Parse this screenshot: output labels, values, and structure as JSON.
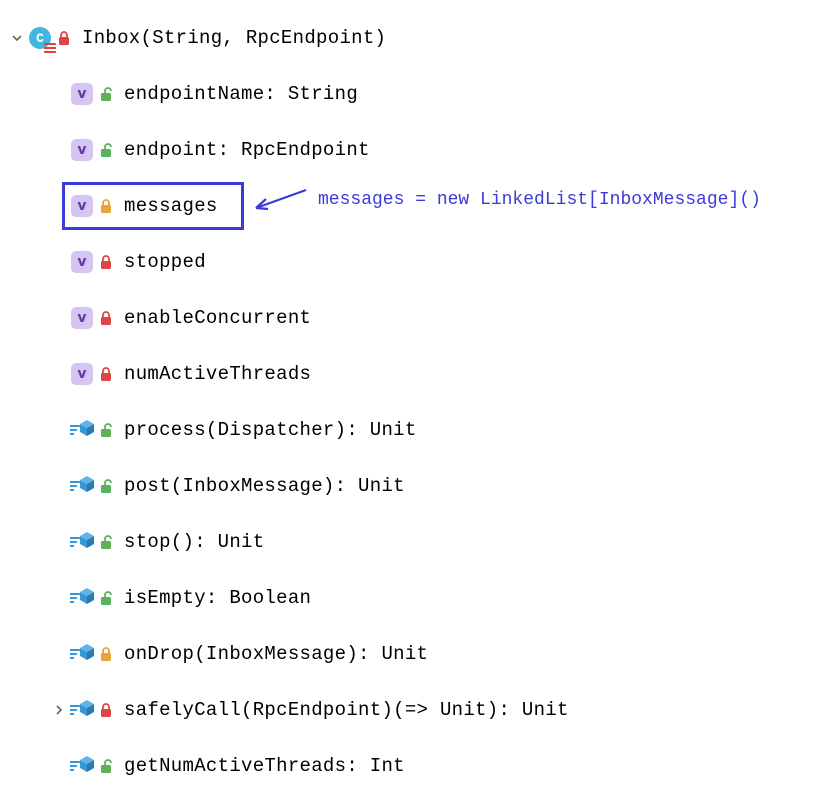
{
  "header": {
    "label": "Inbox(String, RpcEndpoint)",
    "lock": "locked-red"
  },
  "members": [
    {
      "kind": "val",
      "lock": "open-green",
      "label": "endpointName: String"
    },
    {
      "kind": "val",
      "lock": "open-green",
      "label": "endpoint: RpcEndpoint"
    },
    {
      "kind": "val",
      "lock": "locked-gold",
      "label": "messages",
      "highlight": true,
      "annotation": "messages = new LinkedList[InboxMessage]()"
    },
    {
      "kind": "val",
      "lock": "locked-red",
      "label": "stopped"
    },
    {
      "kind": "val",
      "lock": "locked-red",
      "label": "enableConcurrent"
    },
    {
      "kind": "val",
      "lock": "locked-red",
      "label": "numActiveThreads"
    },
    {
      "kind": "method",
      "lock": "open-green",
      "label": "process(Dispatcher): Unit"
    },
    {
      "kind": "method",
      "lock": "open-green",
      "label": "post(InboxMessage): Unit"
    },
    {
      "kind": "method",
      "lock": "open-green",
      "label": "stop(): Unit"
    },
    {
      "kind": "method",
      "lock": "open-green",
      "label": "isEmpty: Boolean"
    },
    {
      "kind": "method",
      "lock": "locked-gold",
      "label": "onDrop(InboxMessage): Unit"
    },
    {
      "kind": "method",
      "lock": "locked-red",
      "label": "safelyCall(RpcEndpoint)(=> Unit): Unit",
      "expandable": true
    },
    {
      "kind": "method",
      "lock": "open-green",
      "label": "getNumActiveThreads: Int"
    }
  ],
  "chevrons": {
    "down": "▾",
    "right": "›"
  }
}
